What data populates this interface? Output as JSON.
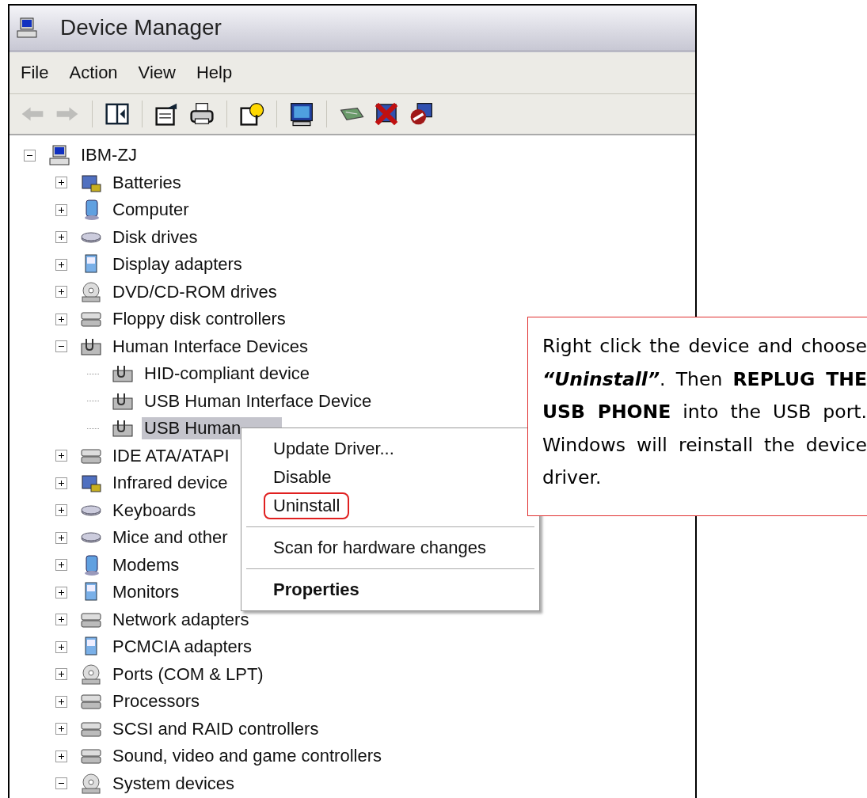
{
  "window": {
    "title": "Device Manager"
  },
  "menu_bar": [
    "File",
    "Action",
    "View",
    "Help"
  ],
  "toolbar": [
    {
      "disabled": true
    },
    {
      "disabled": true
    },
    {
      "disabled": false
    },
    {
      "disabled": false
    },
    {
      "disabled": false
    },
    {
      "disabled": false
    },
    {
      "disabled": false
    },
    {
      "disabled": false
    },
    {
      "disabled": false
    },
    {
      "disabled": false
    }
  ],
  "tree": {
    "label": "IBM-ZJ",
    "expanded": true,
    "selected": false,
    "children": [
      {
        "label": "Batteries",
        "expanded": false,
        "selected": false
      },
      {
        "label": "Computer",
        "expanded": false,
        "selected": false
      },
      {
        "label": "Disk drives",
        "expanded": false,
        "selected": false
      },
      {
        "label": "Display adapters",
        "expanded": false,
        "selected": false
      },
      {
        "label": "DVD/CD-ROM drives",
        "expanded": false,
        "selected": false
      },
      {
        "label": "Floppy disk controllers",
        "expanded": false,
        "selected": false
      },
      {
        "label": "Human Interface Devices",
        "expanded": true,
        "selected": false,
        "children": [
          {
            "label": "HID-compliant device",
            "selected": false
          },
          {
            "label": "USB Human Interface Device",
            "selected": false
          },
          {
            "label": "USB Human",
            "selected": true
          }
        ]
      },
      {
        "label": "IDE ATA/ATAPI",
        "expanded": false,
        "selected": false
      },
      {
        "label": "Infrared device",
        "expanded": false,
        "selected": false
      },
      {
        "label": "Keyboards",
        "expanded": false,
        "selected": false
      },
      {
        "label": "Mice and other",
        "expanded": false,
        "selected": false
      },
      {
        "label": "Modems",
        "expanded": false,
        "selected": false
      },
      {
        "label": "Monitors",
        "expanded": false,
        "selected": false
      },
      {
        "label": "Network adapters",
        "expanded": false,
        "selected": false
      },
      {
        "label": "PCMCIA adapters",
        "expanded": false,
        "selected": false
      },
      {
        "label": "Ports (COM & LPT)",
        "expanded": false,
        "selected": false
      },
      {
        "label": "Processors",
        "expanded": false,
        "selected": false
      },
      {
        "label": "SCSI and RAID controllers",
        "expanded": false,
        "selected": false
      },
      {
        "label": "Sound, video and game controllers",
        "expanded": false,
        "selected": false
      },
      {
        "label": "System devices",
        "expanded": true,
        "selected": false
      }
    ]
  },
  "context_menu": [
    {
      "kind": "item",
      "label": "Update Driver...",
      "default": false,
      "circled": false
    },
    {
      "kind": "item",
      "label": "Disable",
      "default": false,
      "circled": false
    },
    {
      "kind": "item",
      "label": "Uninstall",
      "default": false,
      "circled": true
    },
    {
      "kind": "separator"
    },
    {
      "kind": "item",
      "label": "Scan for hardware changes",
      "default": false,
      "circled": false
    },
    {
      "kind": "separator"
    },
    {
      "kind": "item",
      "label": "Properties",
      "default": true,
      "circled": false
    }
  ],
  "callout": {
    "text": "Right click the device and choose *“Uninstall”*. Then **REPLUG THE USB PHONE** into the USB port. Windows will reinstall the device driver."
  }
}
